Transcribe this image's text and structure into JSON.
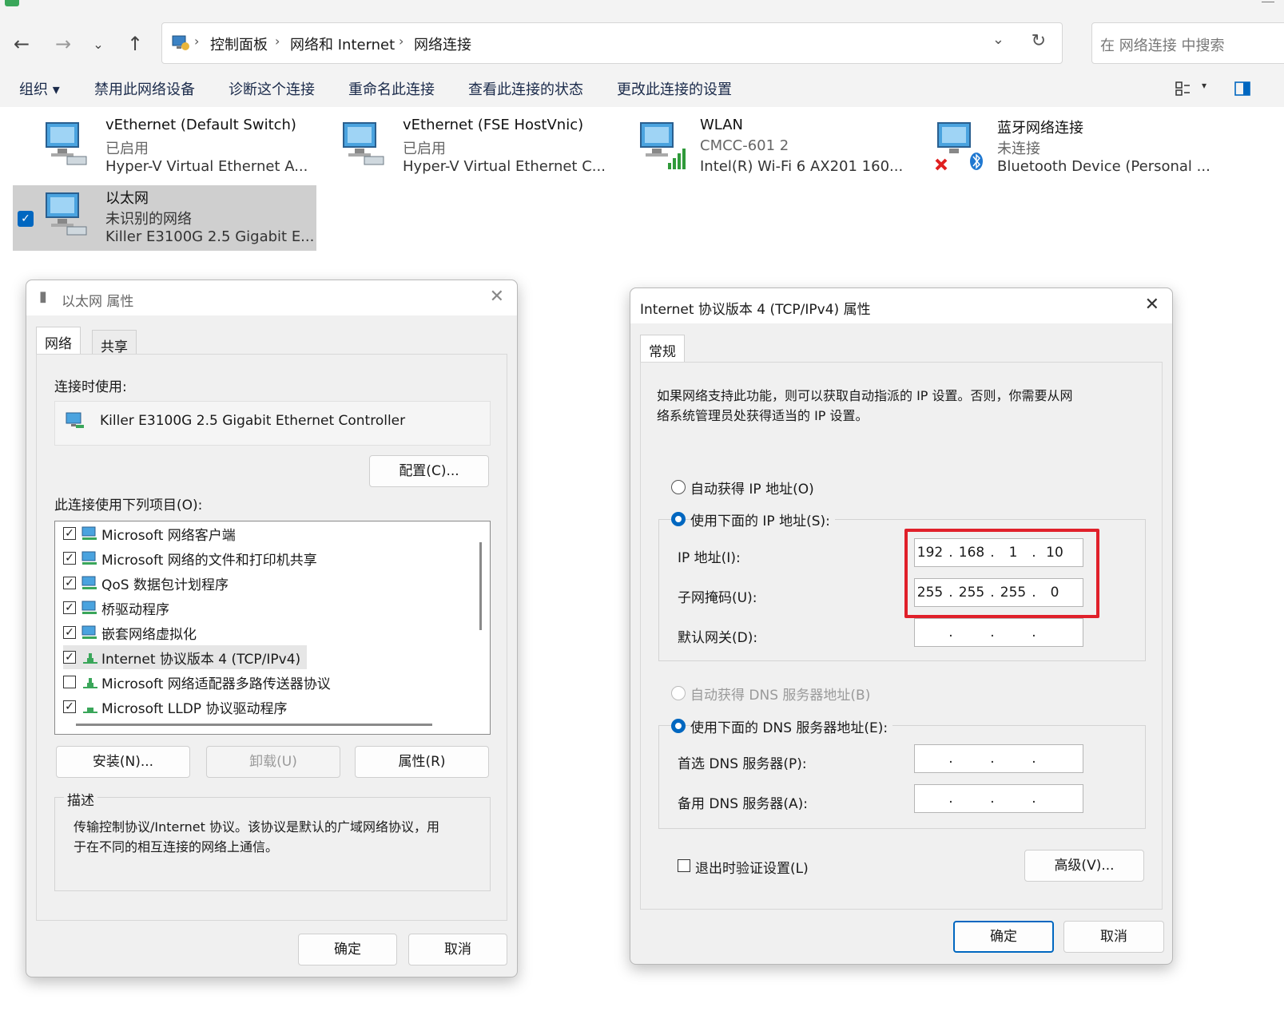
{
  "explorer": {
    "address": {
      "crumbs": [
        "控制面板",
        "网络和 Internet",
        "网络连接"
      ]
    },
    "search_placeholder": "在 网络连接 中搜索",
    "toolbar": [
      "组织 ▾",
      "禁用此网络设备",
      "诊断这个连接",
      "重命名此连接",
      "查看此连接的状态",
      "更改此连接的设置"
    ],
    "connections": [
      {
        "name": "vEthernet (Default Switch)",
        "status": "已启用",
        "device": "Hyper-V Virtual Ethernet A..."
      },
      {
        "name": "vEthernet (FSE HostVnic)",
        "status": "已启用",
        "device": "Hyper-V Virtual Ethernet C..."
      },
      {
        "name": "WLAN",
        "status": "CMCC-601 2",
        "device": "Intel(R) Wi-Fi 6 AX201 160..."
      },
      {
        "name": "蓝牙网络连接",
        "status": "未连接",
        "device": "Bluetooth Device (Personal ..."
      },
      {
        "name": "以太网",
        "status": "未识别的网络",
        "device": "Killer E3100G 2.5 Gigabit E..."
      }
    ]
  },
  "eth_props": {
    "title": "以太网 属性",
    "tabs": [
      "网络",
      "共享"
    ],
    "connect_using_label": "连接时使用:",
    "adapter": "Killer E3100G 2.5 Gigabit Ethernet Controller",
    "configure_btn": "配置(C)...",
    "items_label": "此连接使用下列项目(O):",
    "items": [
      {
        "label": "Microsoft 网络客户端",
        "checked": true
      },
      {
        "label": "Microsoft 网络的文件和打印机共享",
        "checked": true
      },
      {
        "label": "QoS 数据包计划程序",
        "checked": true
      },
      {
        "label": "桥驱动程序",
        "checked": true
      },
      {
        "label": "嵌套网络虚拟化",
        "checked": true
      },
      {
        "label": "Internet 协议版本 4 (TCP/IPv4)",
        "checked": true
      },
      {
        "label": "Microsoft 网络适配器多路传送器协议",
        "checked": false
      },
      {
        "label": "Microsoft LLDP 协议驱动程序",
        "checked": true
      }
    ],
    "install_btn": "安装(N)...",
    "uninstall_btn": "卸载(U)",
    "properties_btn": "属性(R)",
    "desc_label": "描述",
    "desc_line1": "传输控制协议/Internet 协议。该协议是默认的广域网络协议，用",
    "desc_line2": "于在不同的相互连接的网络上通信。",
    "ok": "确定",
    "cancel": "取消"
  },
  "ipv4": {
    "title": "Internet 协议版本 4 (TCP/IPv4) 属性",
    "tab": "常规",
    "intro1": "如果网络支持此功能，则可以获取自动指派的 IP 设置。否则，你需要从网",
    "intro2": "络系统管理员处获得适当的 IP 设置。",
    "auto_ip": "自动获得 IP 地址(O)",
    "manual_ip": "使用下面的 IP 地址(S):",
    "ip_label": "IP 地址(I):",
    "mask_label": "子网掩码(U):",
    "gw_label": "默认网关(D):",
    "ip": [
      "192",
      "168",
      "1",
      "10"
    ],
    "mask": [
      "255",
      "255",
      "255",
      "0"
    ],
    "auto_dns": "自动获得 DNS 服务器地址(B)",
    "manual_dns": "使用下面的 DNS 服务器地址(E):",
    "dns1_label": "首选 DNS 服务器(P):",
    "dns2_label": "备用 DNS 服务器(A):",
    "validate": "退出时验证设置(L)",
    "advanced_btn": "高级(V)...",
    "ok": "确定",
    "cancel": "取消",
    "highlight_color": "#e0202a",
    "accent": "#0067c0"
  }
}
